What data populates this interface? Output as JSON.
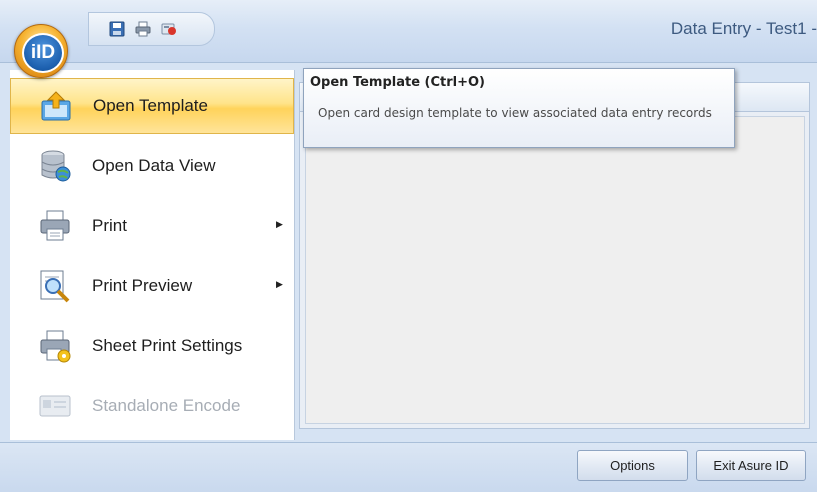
{
  "window": {
    "title": "Data Entry - Test1 -"
  },
  "app_button": {
    "logo_text": "iID"
  },
  "quick_access": [
    {
      "icon": "save-icon"
    },
    {
      "icon": "print-icon"
    },
    {
      "icon": "encode-icon"
    }
  ],
  "menu": {
    "items": [
      {
        "label": "Open Template",
        "icon": "open-template-icon",
        "selected": true,
        "submenu": false,
        "disabled": false
      },
      {
        "label": "Open Data View",
        "icon": "database-icon",
        "selected": false,
        "submenu": false,
        "disabled": false
      },
      {
        "label": "Print",
        "icon": "printer-icon",
        "selected": false,
        "submenu": true,
        "disabled": false
      },
      {
        "label": "Print Preview",
        "icon": "print-preview-icon",
        "selected": false,
        "submenu": true,
        "disabled": false
      },
      {
        "label": "Sheet Print Settings",
        "icon": "print-settings-icon",
        "selected": false,
        "submenu": false,
        "disabled": false
      },
      {
        "label": "Standalone Encode",
        "icon": "encode-card-icon",
        "selected": false,
        "submenu": false,
        "disabled": true
      }
    ]
  },
  "tooltip": {
    "title": "Open Template (Ctrl+O)",
    "body": "Open card design template to view associated data entry records"
  },
  "footer": {
    "options_label": "Options",
    "exit_label": "Exit Asure ID"
  },
  "colors": {
    "highlight": "#ffd35b",
    "accent_blue": "#1c5fae",
    "orb_orange": "#f6b331"
  }
}
